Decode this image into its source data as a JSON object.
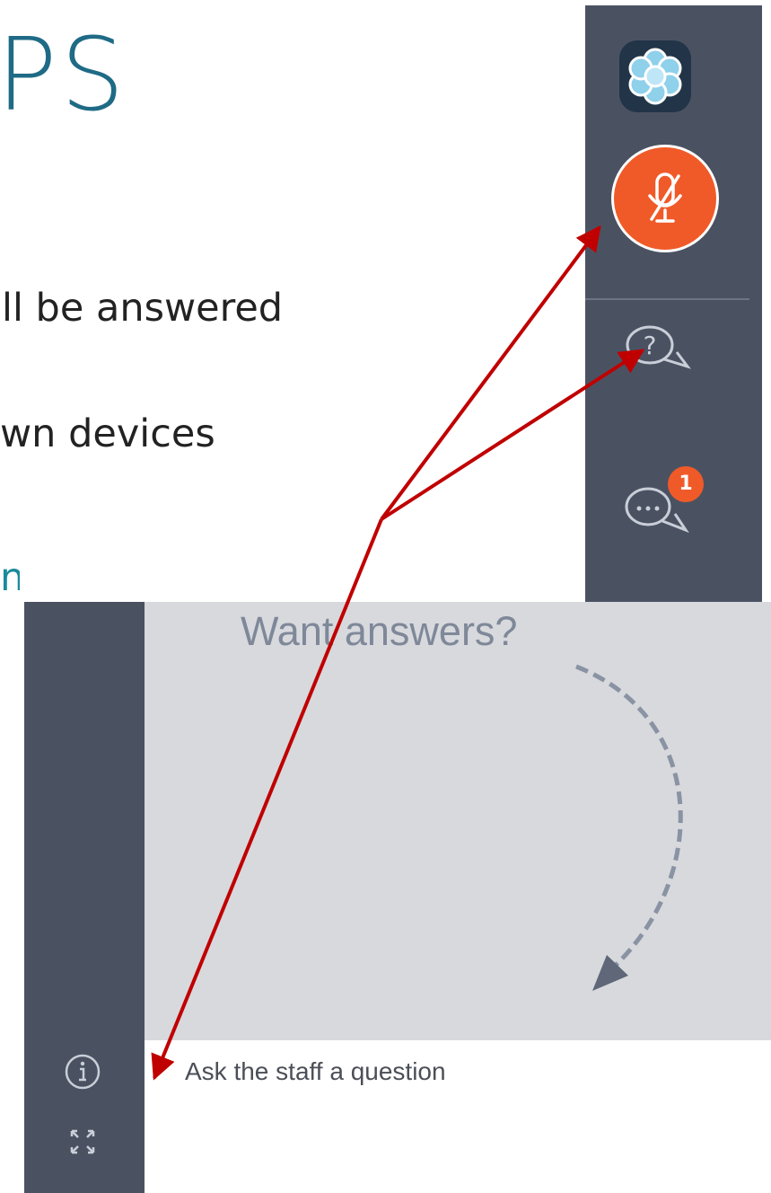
{
  "slide": {
    "title": "PS",
    "bullets": [
      "ll be answered",
      "wn devices",
      "n"
    ]
  },
  "top_sidebar": {
    "icons": [
      "flower-logo-icon",
      "muted-microphone-icon",
      "question-bubble-icon",
      "chat-bubble-icon"
    ],
    "chat_badge_count": "1"
  },
  "bottom_panel": {
    "prompt": "Want answers?",
    "question_input": {
      "placeholder": "Ask the staff a question",
      "value": ""
    },
    "icons": [
      "info-icon",
      "expand-icon",
      "dashed-arrow-icon"
    ]
  },
  "colors": {
    "sidebar_bg": "#4a5262",
    "accent_orange": "#f05a28",
    "title_teal": "#1f6b86",
    "annotation_red": "#c00000",
    "prompt_bg": "#d7d9dd"
  }
}
